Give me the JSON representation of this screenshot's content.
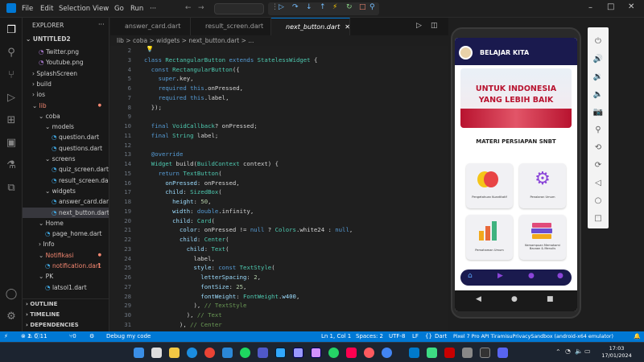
{
  "menu": [
    "File",
    "Edit",
    "Selection",
    "View",
    "Go",
    "Run",
    "···"
  ],
  "explorer": {
    "title": "EXPLORER",
    "project": "UNTITLED2",
    "items": [
      {
        "label": "Twitter.png",
        "indent": 2,
        "kind": "file"
      },
      {
        "label": "Youtube.png",
        "indent": 2,
        "kind": "file"
      },
      {
        "label": "SplashScreen",
        "indent": 1,
        "kind": "folder-closed"
      },
      {
        "label": "build",
        "indent": 1,
        "kind": "folder-closed"
      },
      {
        "label": "ios",
        "indent": 1,
        "kind": "folder-closed"
      },
      {
        "label": "lib",
        "indent": 1,
        "kind": "folder-open",
        "error": true
      },
      {
        "label": "coba",
        "indent": 2,
        "kind": "folder-open"
      },
      {
        "label": "models",
        "indent": 3,
        "kind": "folder-open"
      },
      {
        "label": "question.dart",
        "indent": 4,
        "kind": "file"
      },
      {
        "label": "questions.dart",
        "indent": 4,
        "kind": "file"
      },
      {
        "label": "screens",
        "indent": 3,
        "kind": "folder-open"
      },
      {
        "label": "quiz_screen.dart",
        "indent": 4,
        "kind": "file"
      },
      {
        "label": "result_screen.dart",
        "indent": 4,
        "kind": "file"
      },
      {
        "label": "widgets",
        "indent": 3,
        "kind": "folder-open"
      },
      {
        "label": "answer_card.dart",
        "indent": 4,
        "kind": "file"
      },
      {
        "label": "next_button.dart",
        "indent": 4,
        "kind": "file",
        "selected": true
      },
      {
        "label": "Home",
        "indent": 2,
        "kind": "folder-open"
      },
      {
        "label": "page_home.dart",
        "indent": 3,
        "kind": "file"
      },
      {
        "label": "Info",
        "indent": 2,
        "kind": "folder-closed"
      },
      {
        "label": "Notifikasi",
        "indent": 2,
        "kind": "folder-open",
        "error": true
      },
      {
        "label": "notification.dart",
        "indent": 3,
        "kind": "file",
        "badge": "1"
      },
      {
        "label": "PK",
        "indent": 2,
        "kind": "folder-open"
      },
      {
        "label": "latsol1.dart",
        "indent": 3,
        "kind": "file"
      }
    ],
    "sections": [
      "OUTLINE",
      "TIMELINE",
      "DEPENDENCIES"
    ]
  },
  "tabs": [
    "answer_card.dart",
    "result_screen.dart",
    "next_button.dart"
  ],
  "breadcrumb": "lib > coba > widgets > next_button.dart > ...",
  "code_lines": [
    {
      "n": "2",
      "t": ""
    },
    {
      "n": "3",
      "t": "class RectangularButton extends StatelessWidget {"
    },
    {
      "n": "4",
      "t": "  const RectangularButton({"
    },
    {
      "n": "5",
      "t": "    super.key,"
    },
    {
      "n": "6",
      "t": "    required this.onPressed,"
    },
    {
      "n": "7",
      "t": "    required this.label,"
    },
    {
      "n": "8",
      "t": "  });"
    },
    {
      "n": "9",
      "t": ""
    },
    {
      "n": "10",
      "t": "  final VoidCallback? onPressed;"
    },
    {
      "n": "11",
      "t": "  final String label;"
    },
    {
      "n": "12",
      "t": ""
    },
    {
      "n": "13",
      "t": "  @override"
    },
    {
      "n": "14",
      "t": "  Widget build(BuildContext context) {"
    },
    {
      "n": "15",
      "t": "    return TextButton("
    },
    {
      "n": "16",
      "t": "      onPressed: onPressed,"
    },
    {
      "n": "17",
      "t": "      child: SizedBox("
    },
    {
      "n": "18",
      "t": "        height: 50,"
    },
    {
      "n": "19",
      "t": "        width: double.infinity,"
    },
    {
      "n": "20",
      "t": "        child: Card("
    },
    {
      "n": "21",
      "t": "          color: onPressed != null ? Colors.white24 : null,"
    },
    {
      "n": "22",
      "t": "          child: Center("
    },
    {
      "n": "23",
      "t": "            child: Text("
    },
    {
      "n": "24",
      "t": "              label,"
    },
    {
      "n": "25",
      "t": "              style: const TextStyle("
    },
    {
      "n": "26",
      "t": "                letterSpacing: 2,"
    },
    {
      "n": "27",
      "t": "                fontSize: 25,"
    },
    {
      "n": "28",
      "t": "                fontWeight: FontWeight.w400,"
    },
    {
      "n": "29",
      "t": "              ), // TextStyle"
    },
    {
      "n": "30",
      "t": "            ), // Text"
    },
    {
      "n": "31",
      "t": "          ), // Center"
    }
  ],
  "status": {
    "errors": "1",
    "warnings": "0",
    "info": "11",
    "ports": "0",
    "debug": "Debug my code",
    "position": "Ln 1, Col 1",
    "spaces": "Spaces: 2",
    "encoding": "UTF-8",
    "eol": "LF",
    "language": "Dart",
    "device": "Pixel 7 Pro API TiramisuPrivacySandbox (android-x64 emulator)"
  },
  "phone": {
    "app_title": "BELAJAR KITA",
    "banner_top": "UNTUK INDONESIA",
    "banner_bottom": "YANG LEBIH BAIK",
    "section_title": "MATERI PERSIAPAN SNBT",
    "cards": [
      "Pengetahuan Kuantitatif",
      "Penalaran Umum",
      "Pemahaman Umum",
      "Kemampuan Memahami Bacaan & Menulis"
    ]
  },
  "clock": {
    "time": "17:03",
    "date": "17/01/2024"
  },
  "colors": {
    "accent": "#0078d4",
    "phone_nav": "#1a1a4e"
  }
}
